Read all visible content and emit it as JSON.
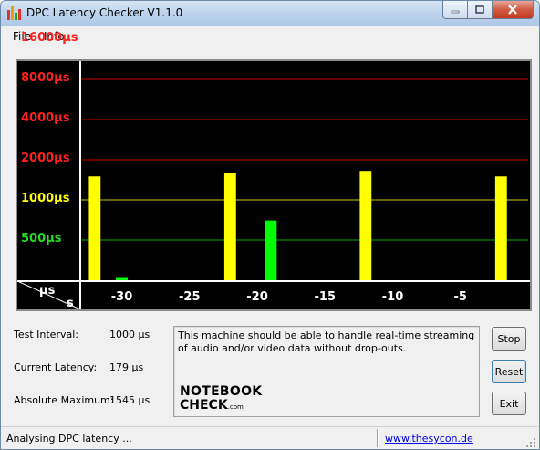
{
  "window": {
    "title": "DPC Latency Checker V1.1.0"
  },
  "menu": {
    "file": "File",
    "info": "Info"
  },
  "plot": {
    "y_ticks": [
      {
        "label": "16000µs",
        "value": 16000,
        "color": "#ff2020"
      },
      {
        "label": "8000µs",
        "value": 8000,
        "color": "#ff2020"
      },
      {
        "label": "4000µs",
        "value": 4000,
        "color": "#ff2020"
      },
      {
        "label": "2000µs",
        "value": 2000,
        "color": "#ff2020"
      },
      {
        "label": "1000µs",
        "value": 1000,
        "color": "#ffff00"
      },
      {
        "label": "500µs",
        "value": 500,
        "color": "#22dd22"
      }
    ],
    "x_ticks": [
      "-30",
      "-25",
      "-20",
      "-15",
      "-10",
      "-5"
    ],
    "unit_y": "µs",
    "unit_x": "s",
    "colors": {
      "green": "#00ff00",
      "yellow": "#ffff00",
      "red_line": "#cc0000",
      "yellow_line": "#cccc00",
      "green_line": "#00aa00"
    }
  },
  "chart_data": {
    "type": "bar",
    "y_scale": "log",
    "ylabel": "µs",
    "xlabel": "s",
    "x_range": [
      -33,
      0
    ],
    "x": [
      -32,
      -31,
      -30,
      -29,
      -28,
      -27,
      -26,
      -25,
      -24,
      -23,
      -22,
      -21,
      -20,
      -19,
      -18,
      -17,
      -16,
      -15,
      -14,
      -13,
      -12,
      -11,
      -10,
      -9,
      -8,
      -7,
      -6,
      -5,
      -4,
      -3,
      -2,
      -1
    ],
    "values": [
      1500,
      210,
      260,
      220,
      210,
      210,
      220,
      220,
      210,
      230,
      1600,
      210,
      220,
      700,
      190,
      210,
      200,
      190,
      210,
      180,
      1650,
      190,
      190,
      200,
      210,
      200,
      200,
      240,
      200,
      210,
      1500,
      179
    ]
  },
  "stats": {
    "test_interval_label": "Test Interval:",
    "test_interval_value": "1000 µs",
    "current_latency_label": "Current Latency:",
    "current_latency_value": "179 µs",
    "absolute_max_label": "Absolute Maximum:",
    "absolute_max_value": "1545 µs"
  },
  "message": "This machine should be able to handle real-time streaming of audio and/or video data without drop-outs.",
  "logo": {
    "line1": "NOTEBOOK",
    "line2": "CHECK",
    "line3": ".com"
  },
  "buttons": {
    "stop": "Stop",
    "reset": "Reset",
    "exit": "Exit"
  },
  "status": {
    "text": "Analysing DPC latency ...",
    "link": "www.thesycon.de"
  }
}
